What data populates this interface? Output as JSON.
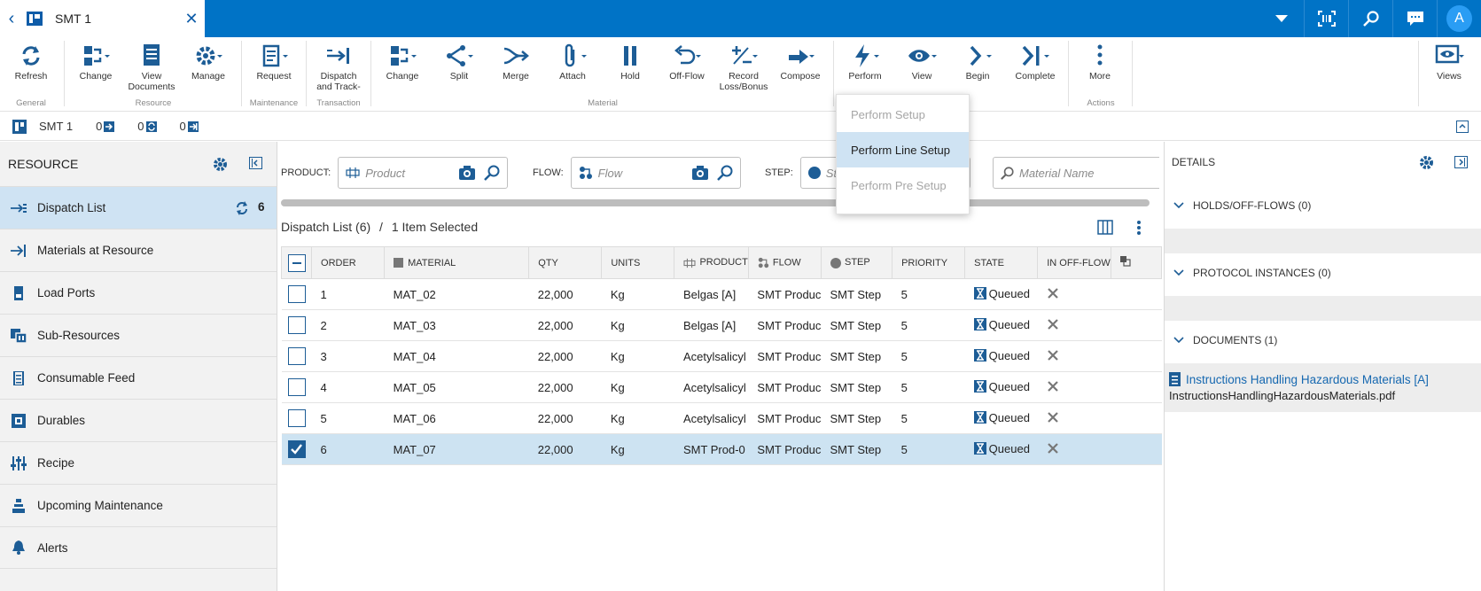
{
  "tab": {
    "title": "SMT 1"
  },
  "topbar": {
    "avatar_letter": "A"
  },
  "ribbon": {
    "buttons": [
      {
        "label": "Refresh",
        "icon": "refresh-icon"
      },
      {
        "label": "Change",
        "icon": "change-icon"
      },
      {
        "label": "View Documents",
        "icon": "documents-icon"
      },
      {
        "label": "Manage",
        "icon": "gear-icon"
      },
      {
        "label": "Request",
        "icon": "request-icon"
      },
      {
        "label": "Dispatch and Track-",
        "icon": "dispatch-icon"
      },
      {
        "label": "Change",
        "icon": "change-icon"
      },
      {
        "label": "Split",
        "icon": "split-icon"
      },
      {
        "label": "Merge",
        "icon": "merge-icon"
      },
      {
        "label": "Attach",
        "icon": "paperclip-icon"
      },
      {
        "label": "Hold",
        "icon": "pause-icon"
      },
      {
        "label": "Off-Flow",
        "icon": "undo-icon"
      },
      {
        "label": "Record Loss/Bonus",
        "icon": "plus-minus-icon"
      },
      {
        "label": "Compose",
        "icon": "compose-icon"
      },
      {
        "label": "Perform",
        "icon": "lightning-icon"
      },
      {
        "label": "View",
        "icon": "eye-icon"
      },
      {
        "label": "Begin",
        "icon": "chevron-right-icon"
      },
      {
        "label": "Complete",
        "icon": "complete-icon"
      },
      {
        "label": "More",
        "icon": "more-vertical-icon"
      },
      {
        "label": "Views",
        "icon": "views-icon"
      }
    ],
    "groups": [
      "General",
      "Resource",
      "Maintenance",
      "Transaction",
      "Material",
      "Actions"
    ]
  },
  "subheader": {
    "name": "SMT 1",
    "count_in": "0",
    "count_process": "0",
    "count_out": "0"
  },
  "left_panel": {
    "title": "RESOURCE",
    "items": [
      {
        "label": "Dispatch List",
        "badge": "6"
      },
      {
        "label": "Materials at Resource"
      },
      {
        "label": "Load Ports"
      },
      {
        "label": "Sub-Resources"
      },
      {
        "label": "Consumable Feed"
      },
      {
        "label": "Durables"
      },
      {
        "label": "Recipe"
      },
      {
        "label": "Upcoming Maintenance"
      },
      {
        "label": "Alerts"
      }
    ]
  },
  "filters": {
    "product_label": "PRODUCT:",
    "product_placeholder": "Product",
    "flow_label": "FLOW:",
    "flow_placeholder": "Flow",
    "step_label": "STEP:",
    "step_placeholder": "St",
    "material_placeholder": "Material Name"
  },
  "dispatch": {
    "title": "Dispatch List (6)",
    "selection": "1 Item Selected",
    "columns": [
      "ORDER",
      "MATERIAL",
      "QTY",
      "UNITS",
      "PRODUCT",
      "FLOW",
      "STEP",
      "PRIORITY",
      "STATE",
      "IN OFF-FLOW"
    ],
    "rows": [
      {
        "order": "1",
        "material": "MAT_02",
        "qty": "22,000",
        "units": "Kg",
        "product": "Belgas [A]",
        "flow": "SMT Produc",
        "step": "SMT Step",
        "priority": "5",
        "state": "Queued"
      },
      {
        "order": "2",
        "material": "MAT_03",
        "qty": "22,000",
        "units": "Kg",
        "product": "Belgas [A]",
        "flow": "SMT Produc",
        "step": "SMT Step",
        "priority": "5",
        "state": "Queued"
      },
      {
        "order": "3",
        "material": "MAT_04",
        "qty": "22,000",
        "units": "Kg",
        "product": "Acetylsalicyl",
        "flow": "SMT Produc",
        "step": "SMT Step",
        "priority": "5",
        "state": "Queued"
      },
      {
        "order": "4",
        "material": "MAT_05",
        "qty": "22,000",
        "units": "Kg",
        "product": "Acetylsalicyl",
        "flow": "SMT Produc",
        "step": "SMT Step",
        "priority": "5",
        "state": "Queued"
      },
      {
        "order": "5",
        "material": "MAT_06",
        "qty": "22,000",
        "units": "Kg",
        "product": "Acetylsalicyl",
        "flow": "SMT Produc",
        "step": "SMT Step",
        "priority": "5",
        "state": "Queued"
      },
      {
        "order": "6",
        "material": "MAT_07",
        "qty": "22,000",
        "units": "Kg",
        "product": "SMT Prod-0",
        "flow": "SMT Produc",
        "step": "SMT Step",
        "priority": "5",
        "state": "Queued"
      }
    ]
  },
  "details": {
    "title": "DETAILS",
    "holds": "HOLDS/OFF-FLOWS (0)",
    "protocols": "PROTOCOL INSTANCES (0)",
    "documents": "DOCUMENTS (1)",
    "doc_name": "Instructions Handling Hazardous Materials [A]",
    "doc_file": "InstructionsHandlingHazardousMaterials.pdf"
  },
  "perform_menu": {
    "items": [
      "Perform Setup",
      "Perform Line Setup",
      "Perform Pre Setup"
    ]
  },
  "colors": {
    "brand": "#0073c6",
    "accent": "#1d5d96",
    "selected": "#cde3f2"
  }
}
